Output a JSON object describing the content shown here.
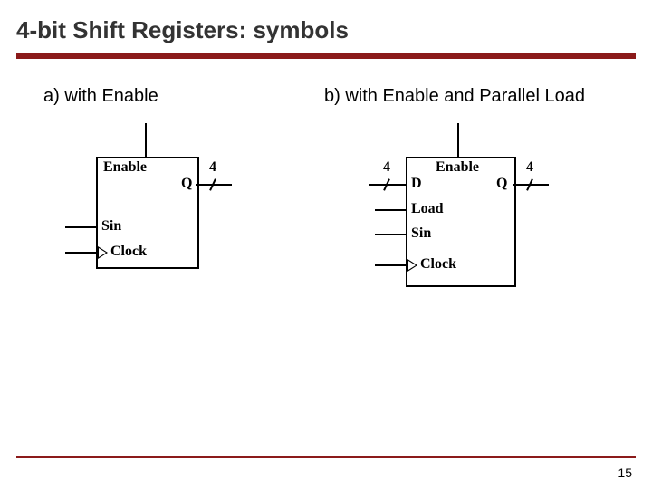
{
  "title": "4-bit Shift Registers: symbols",
  "subtitle_a": "a) with Enable",
  "subtitle_b": "b) with Enable and Parallel Load",
  "diagA": {
    "enable": "Enable",
    "q": "Q",
    "bus4": "4",
    "sin": "Sin",
    "clock": "Clock"
  },
  "diagB": {
    "enable": "Enable",
    "d": "D",
    "q": "Q",
    "bus4_in": "4",
    "bus4_out": "4",
    "load": "Load",
    "sin": "Sin",
    "clock": "Clock"
  },
  "page": "15"
}
